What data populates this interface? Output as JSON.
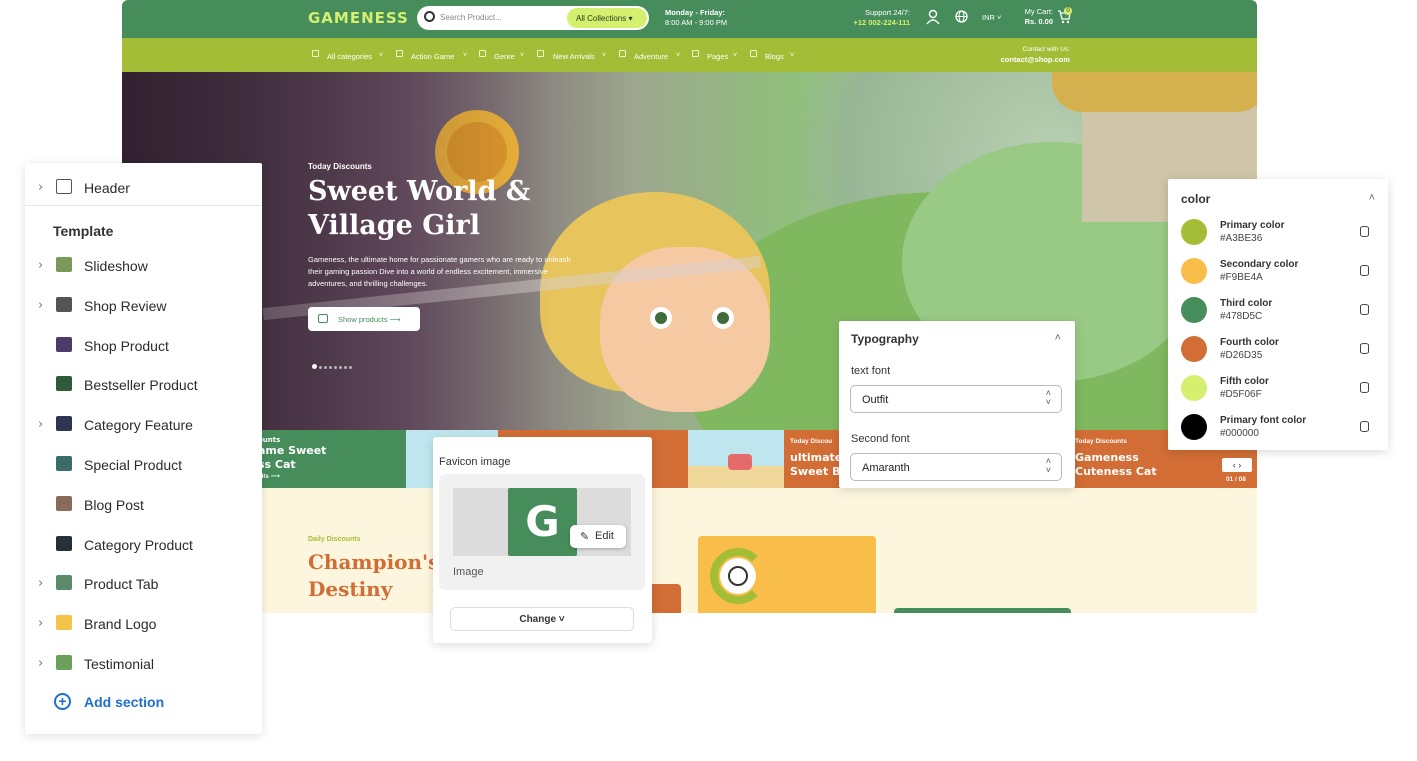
{
  "store": {
    "logo": "GAMENESS",
    "search_placeholder": "Search Product...",
    "collections": "All Collections",
    "hours_title": "Monday - Friday:",
    "hours": "8:00 AM - 9:00 PM",
    "support_title": "Support 24/7:",
    "support_phone": "+12 002-224-111",
    "currency": "INR",
    "cart_title": "My Cart:",
    "cart_total": "Rs. 0.00",
    "cart_count": "0",
    "nav": [
      "All categories",
      "Action Game",
      "Genre",
      "New Arrivals",
      "Adventure",
      "Pages",
      "Blogs"
    ],
    "contact_title": "Contact with Us:",
    "contact_email": "contact@shop.com",
    "hero": {
      "eyebrow": "Today Discounts",
      "title": "Sweet World & Village Girl",
      "desc": "Gameness, the ultimate home for passionate gamers who are ready to unleash their gaming passion Dive into a world of endless excitement, immersive adventures, and thrilling challenges.",
      "button": "Show products"
    },
    "banners": [
      {
        "eyebrow": "ounts",
        "title": "ame Sweet ss Cat",
        "link": "ails"
      },
      {
        "eyebrow": "Today Discou",
        "title": "ultimate Sweet Be"
      },
      {
        "eyebrow": "Today Discounts",
        "title": "Gameness Cuteness Cat"
      }
    ],
    "pager": "01 / 08",
    "lower": {
      "eyebrow": "Daily Discounts",
      "title": "Champion's Destiny"
    }
  },
  "left_panel": {
    "header_label": "Header",
    "template_label": "Template",
    "items": [
      {
        "label": "Slideshow",
        "chevron": true
      },
      {
        "label": "Shop Review",
        "chevron": true
      },
      {
        "label": "Shop Product",
        "chevron": false
      },
      {
        "label": "Bestseller Product",
        "chevron": false
      },
      {
        "label": "Category Feature",
        "chevron": true
      },
      {
        "label": "Special Product",
        "chevron": false
      },
      {
        "label": "Blog Post",
        "chevron": false
      },
      {
        "label": "Category Product",
        "chevron": false
      },
      {
        "label": "Product Tab",
        "chevron": true
      },
      {
        "label": "Brand Logo",
        "chevron": true
      },
      {
        "label": "Testimonial",
        "chevron": true
      }
    ],
    "add_section": "Add section"
  },
  "favicon": {
    "title": "Favicon image",
    "letter": "G",
    "edit": "Edit",
    "image_label": "Image",
    "change": "Change"
  },
  "typography": {
    "title": "Typography",
    "text_font_label": "text font",
    "text_font": "Outfit",
    "second_font_label": "Second font",
    "second_font": "Amaranth"
  },
  "colors": {
    "title": "color",
    "items": [
      {
        "name": "Primary color",
        "hex": "#A3BE36"
      },
      {
        "name": "Secondary color",
        "hex": "#F9BE4A"
      },
      {
        "name": "Third color",
        "hex": "#478D5C"
      },
      {
        "name": "Fourth color",
        "hex": "#D26D35"
      },
      {
        "name": "Fifth color",
        "hex": "#D5F06F"
      },
      {
        "name": "Primary font color",
        "hex": "#000000"
      }
    ]
  }
}
